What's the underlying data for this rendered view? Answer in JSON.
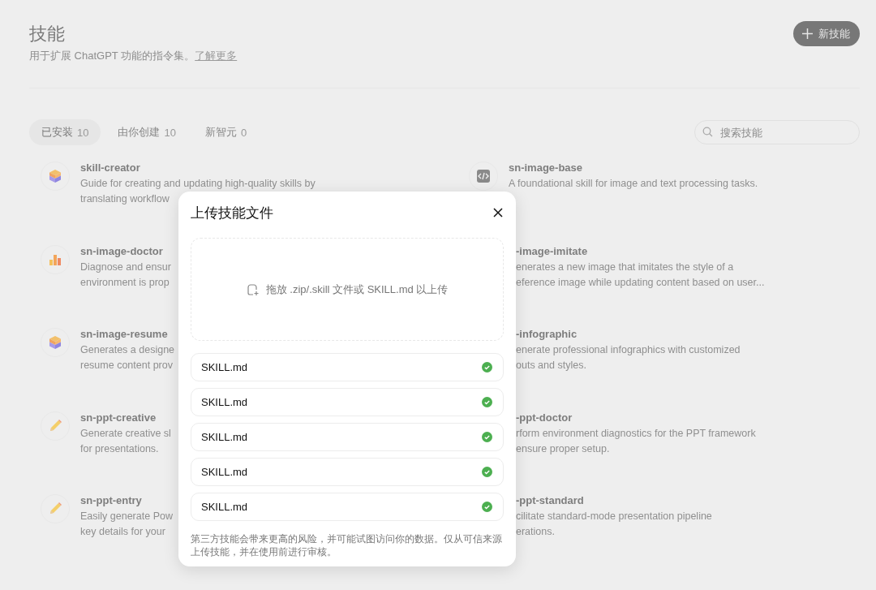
{
  "page": {
    "title": "技能",
    "subtitle": "用于扩展 ChatGPT 功能的指令集。",
    "learn_more": "了解更多",
    "new_button": "新技能"
  },
  "tabs": [
    {
      "label": "已安装",
      "count": "10",
      "selected": true
    },
    {
      "label": "由你创建",
      "count": "10",
      "selected": false
    },
    {
      "label": "新智元",
      "count": "0",
      "selected": false
    }
  ],
  "search": {
    "placeholder": "搜索技能"
  },
  "skills_left": [
    {
      "kind": "cube",
      "name": "skill-creator",
      "lines": [
        "Guide for creating and updating high-quality skills by",
        "translating workflow"
      ]
    },
    {
      "kind": "chart",
      "name": "sn-image-doctor",
      "lines": [
        "Diagnose and ensur",
        "environment is prop"
      ]
    },
    {
      "kind": "cube",
      "name": "sn-image-resume",
      "lines": [
        "Generates a designe",
        "resume content prov"
      ]
    },
    {
      "kind": "pencil",
      "name": "sn-ppt-creative",
      "lines": [
        "Generate creative sl",
        "for presentations."
      ]
    },
    {
      "kind": "pencil",
      "name": "sn-ppt-entry",
      "lines": [
        "Easily generate Pow",
        "key details for your"
      ]
    }
  ],
  "skills_right": [
    {
      "kind": "code",
      "name": "sn-image-base",
      "lines": [
        "A foundational skill for image and text processing tasks."
      ]
    },
    {
      "kind": "covered",
      "name": "-image-imitate",
      "lines": [
        "enerates a new image that imitates the style of a",
        "eference image while updating content based on user..."
      ]
    },
    {
      "kind": "covered",
      "name": "-infographic",
      "lines": [
        "enerate professional infographics with customized",
        "outs and styles."
      ]
    },
    {
      "kind": "covered",
      "name": "-ppt-doctor",
      "lines": [
        "rform environment diagnostics for the PPT framework",
        "ensure proper setup."
      ]
    },
    {
      "kind": "covered",
      "name": "-ppt-standard",
      "lines": [
        "cilitate standard-mode presentation pipeline",
        "erations."
      ]
    }
  ],
  "dialog": {
    "title": "上传技能文件",
    "dropzone": "拖放 .zip/.skill 文件或 SKILL.md 以上传",
    "files": [
      {
        "name": "SKILL.md",
        "done": true
      },
      {
        "name": "SKILL.md",
        "done": true
      },
      {
        "name": "SKILL.md",
        "done": true
      },
      {
        "name": "SKILL.md",
        "done": true
      },
      {
        "name": "SKILL.md",
        "done": true
      }
    ],
    "warning": "第三方技能会带来更高的风险，并可能试图访问你的数据。仅从可信来源上传技能，并在使用前进行审核。"
  }
}
